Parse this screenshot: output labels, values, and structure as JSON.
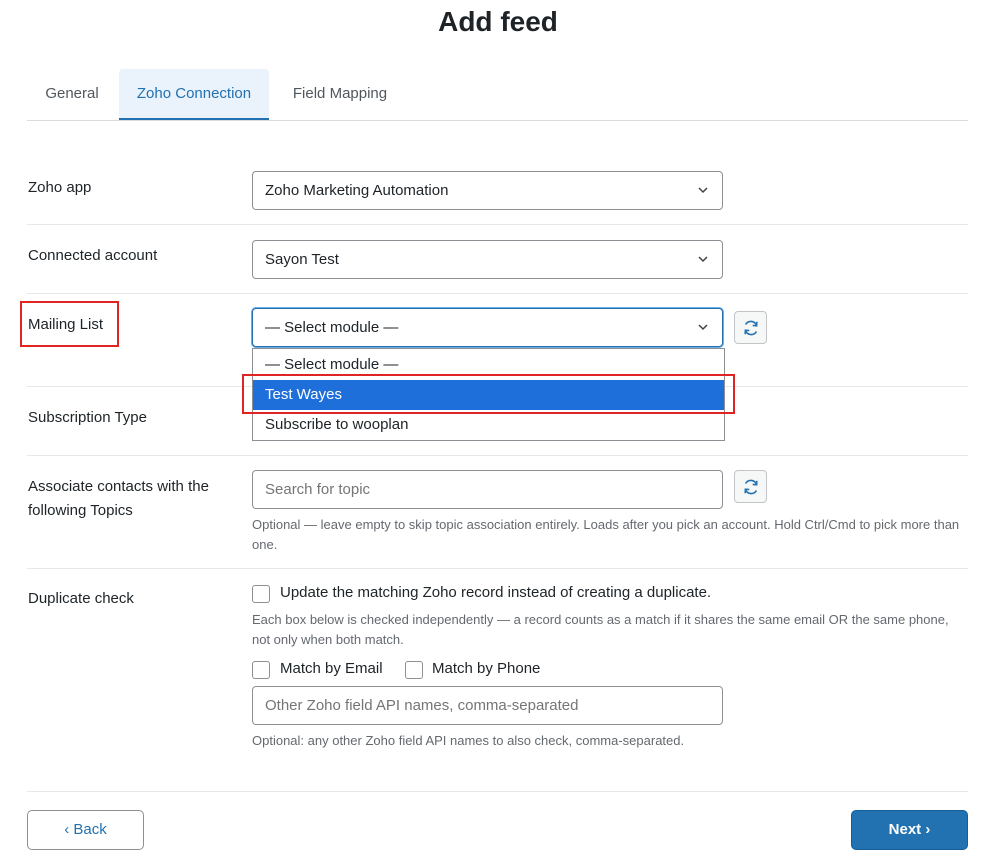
{
  "page": {
    "title": "Add feed"
  },
  "tabs": [
    {
      "label": "General"
    },
    {
      "label": "Zoho Connection",
      "active": true
    },
    {
      "label": "Field Mapping"
    }
  ],
  "form": {
    "zoho_app": {
      "label": "Zoho app",
      "value": "Zoho Marketing Automation"
    },
    "connected_account": {
      "label": "Connected account",
      "value": "Sayon Test"
    },
    "mailing_list": {
      "label": "Mailing List",
      "value": "— Select module —",
      "options": [
        "— Select module —",
        "Test Wayes",
        "Subscribe to wooplan"
      ],
      "highlighted_option": "Test Wayes"
    },
    "subscription_type": {
      "label": "Subscription Type"
    },
    "topics": {
      "label_line1": "Associate contacts with the",
      "label_line2": "following Topics",
      "placeholder": "Search for topic",
      "help": "Optional — leave empty to skip topic association entirely. Loads after you pick an account. Hold Ctrl/Cmd to pick more than one."
    },
    "duplicate_check": {
      "label": "Duplicate check",
      "update_label": "Update the matching Zoho record instead of creating a duplicate.",
      "update_checked": false,
      "help": "Each box below is checked independently — a record counts as a match if it shares the same email OR the same phone, not only when both match.",
      "match_email_label": "Match by Email",
      "match_email_checked": false,
      "match_phone_label": "Match by Phone",
      "match_phone_checked": false,
      "other_fields_placeholder": "Other Zoho field API names, comma-separated",
      "other_help": "Optional: any other Zoho field API names to also check, comma-separated."
    }
  },
  "footer": {
    "back_label": "‹ Back",
    "next_label": "Next ›"
  },
  "colors": {
    "accent": "#2271b1",
    "highlight": "#e02424",
    "selected_option": "#1e6fd9"
  }
}
